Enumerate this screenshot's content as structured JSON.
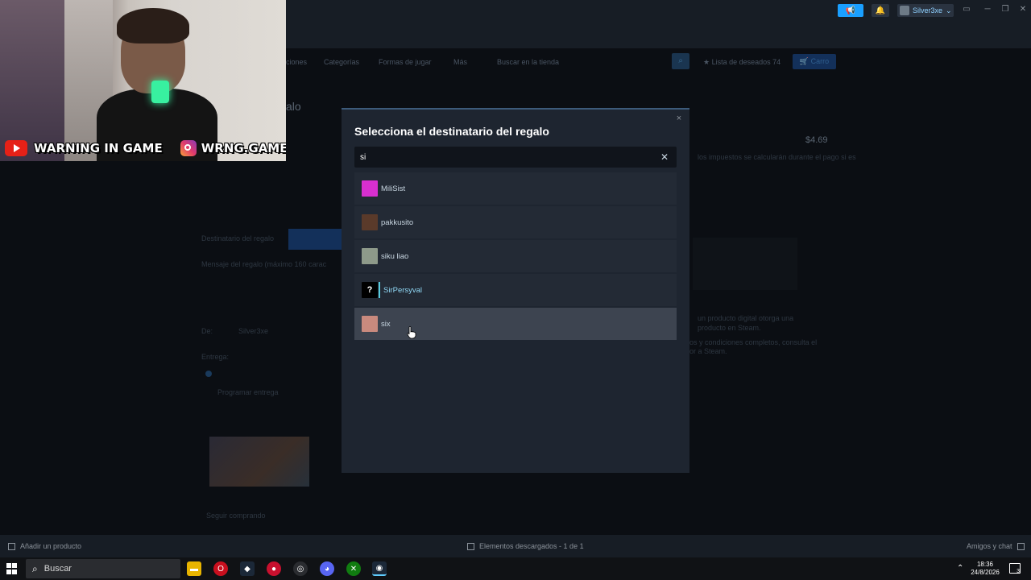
{
  "titlebar": {
    "user_name": "Silver3xe",
    "minimize": "─",
    "maximize": "❐",
    "close": "✕"
  },
  "store_nav": {
    "items": [
      "ciones",
      "Categorías",
      "Formas de jugar",
      "Más"
    ],
    "search_placeholder": "Buscar en la tienda",
    "wishlist_label": "Lista de deseados",
    "wishlist_count": "74",
    "cart_label": "Carro"
  },
  "background_page": {
    "heading_fragment": "alo",
    "price": "$4.69",
    "recipient_label": "Destinatario del regalo",
    "message_label": "Mensaje del regalo (máximo 160 carac",
    "from_label": "De:",
    "from_user": "Silver3xe",
    "delivery_label": "Entrega:",
    "schedule_label": "Programar entrega",
    "continue_shopping": "Seguir comprando",
    "tax_note": "los impuestos se calcularán durante el pago si es",
    "digital_note": "un producto digital otorga una",
    "digital_note2": "producto en Steam.",
    "terms_note": "os y condiciones completos, consulta el",
    "terms_note2": "or a Steam."
  },
  "modal": {
    "title": "Selecciona el destinatario del regalo",
    "close_glyph": "×",
    "search_value": "si",
    "clear_glyph": "✕",
    "friends": [
      {
        "name": "MiliSist",
        "avatar_color": "#d82fd0",
        "avatar_glyph": "",
        "in_game": false,
        "hover": false
      },
      {
        "name": "pakkusito",
        "avatar_color": "#5a3a2a",
        "avatar_glyph": "",
        "in_game": false,
        "hover": false
      },
      {
        "name": "siku liao",
        "avatar_color": "#8e9a8a",
        "avatar_glyph": "",
        "in_game": false,
        "hover": false
      },
      {
        "name": "SirPersyval",
        "avatar_color": "#000000",
        "avatar_glyph": "?",
        "in_game": true,
        "hover": false
      },
      {
        "name": "six",
        "avatar_color": "#c98a7e",
        "avatar_glyph": "",
        "in_game": false,
        "hover": true
      }
    ]
  },
  "bottom_bar": {
    "add_product": "Añadir un producto",
    "downloads": "Elementos descargados - 1 de 1",
    "friends_chat": "Amigos y chat"
  },
  "webcam": {
    "youtube_handle": "WARNING IN GAME",
    "instagram_handle": "WRNG.GAME"
  },
  "taskbar": {
    "search_label": "Buscar",
    "time": "18:36",
    "date": "24/8/2026",
    "notification_count": "3"
  },
  "colors": {
    "accent": "#1a9fff",
    "modal_bg": "#1e2530",
    "row_hover": "#3d4450",
    "in_game_name": "#90d8f5"
  }
}
